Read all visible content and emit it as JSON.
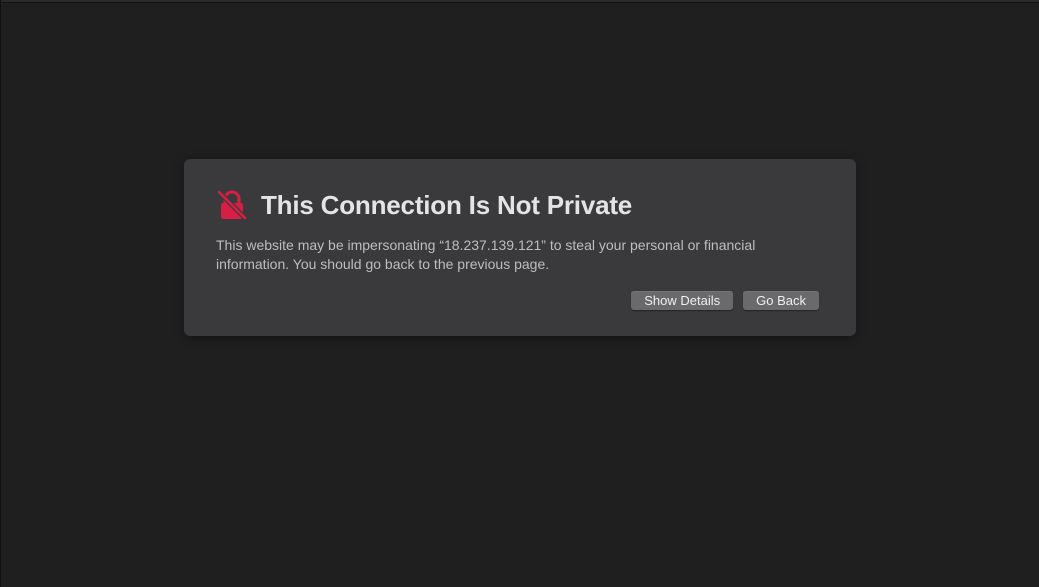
{
  "dialog": {
    "icon": "broken-lock-icon",
    "icon_color": "#d81e45",
    "title": "This Connection Is Not Private",
    "message": "This website may be impersonating “18.237.139.121” to steal your personal or financial information. You should go back to the previous page.",
    "buttons": {
      "show_details": "Show Details",
      "go_back": "Go Back"
    }
  }
}
